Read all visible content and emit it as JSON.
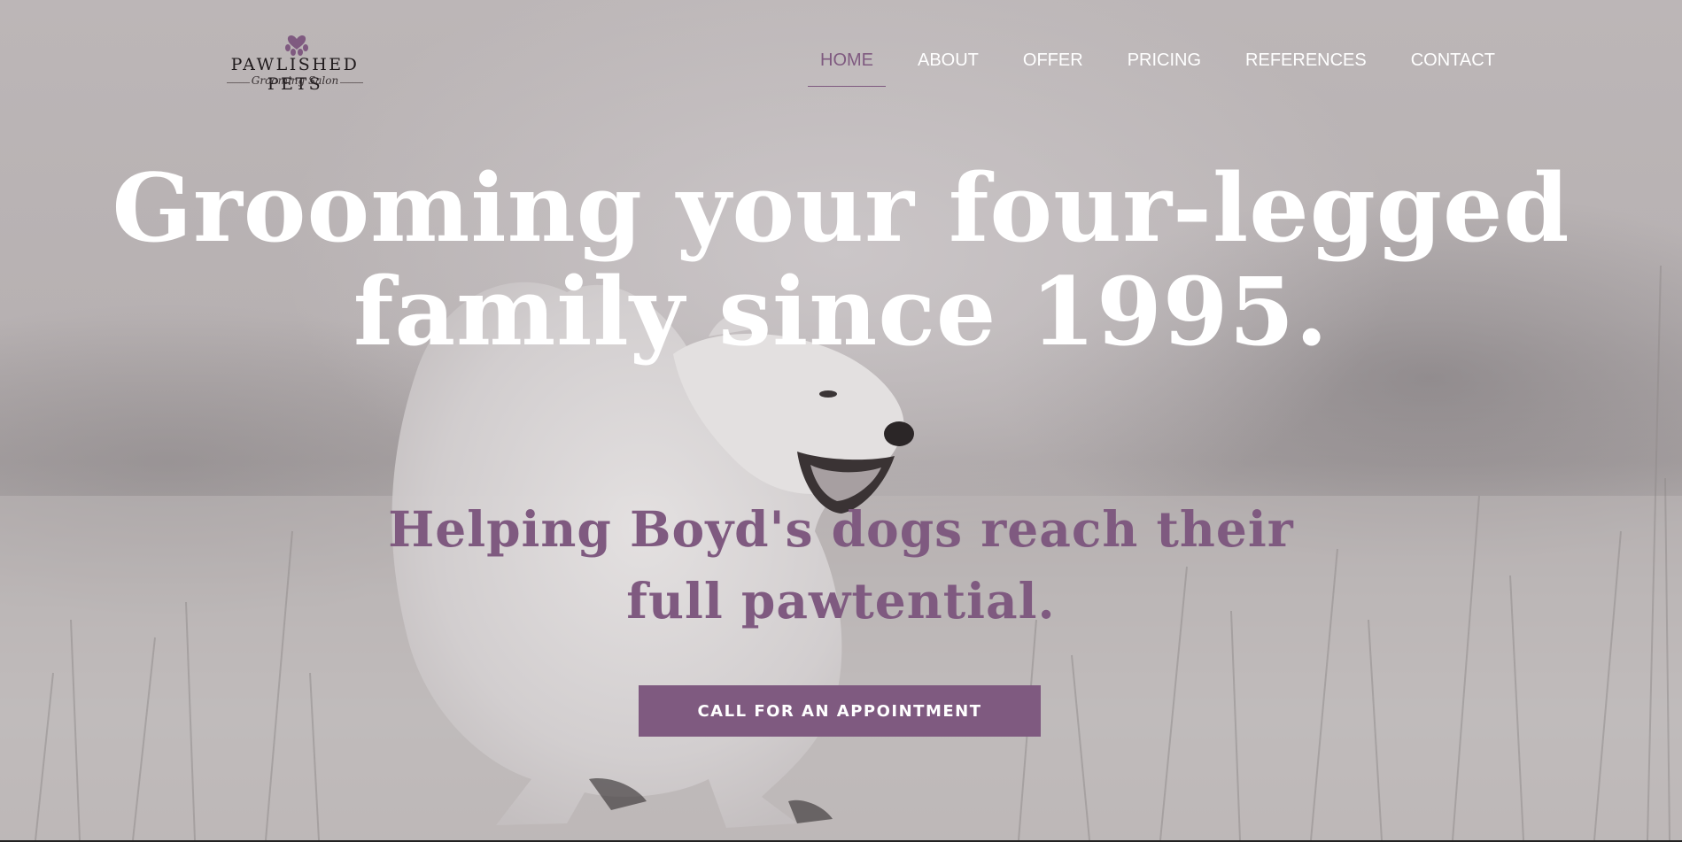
{
  "brand": {
    "name": "PAWLISHED PETS",
    "tagline": "Grooming Salon",
    "accent_color": "#7f5a80",
    "logo_icon": "paw-heart-icon"
  },
  "nav": {
    "items": [
      {
        "label": "HOME",
        "active": true
      },
      {
        "label": "ABOUT",
        "active": false
      },
      {
        "label": "OFFER",
        "active": false
      },
      {
        "label": "PRICING",
        "active": false
      },
      {
        "label": "REFERENCES",
        "active": false
      },
      {
        "label": "CONTACT",
        "active": false
      }
    ]
  },
  "hero": {
    "headline_line1": "Grooming your four-legged",
    "headline_line2": "family since 1995.",
    "subheadline_line1": "Helping Boyd's dogs reach their",
    "subheadline_line2": "full pawtential.",
    "cta_label": "CALL FOR AN APPOINTMENT"
  }
}
